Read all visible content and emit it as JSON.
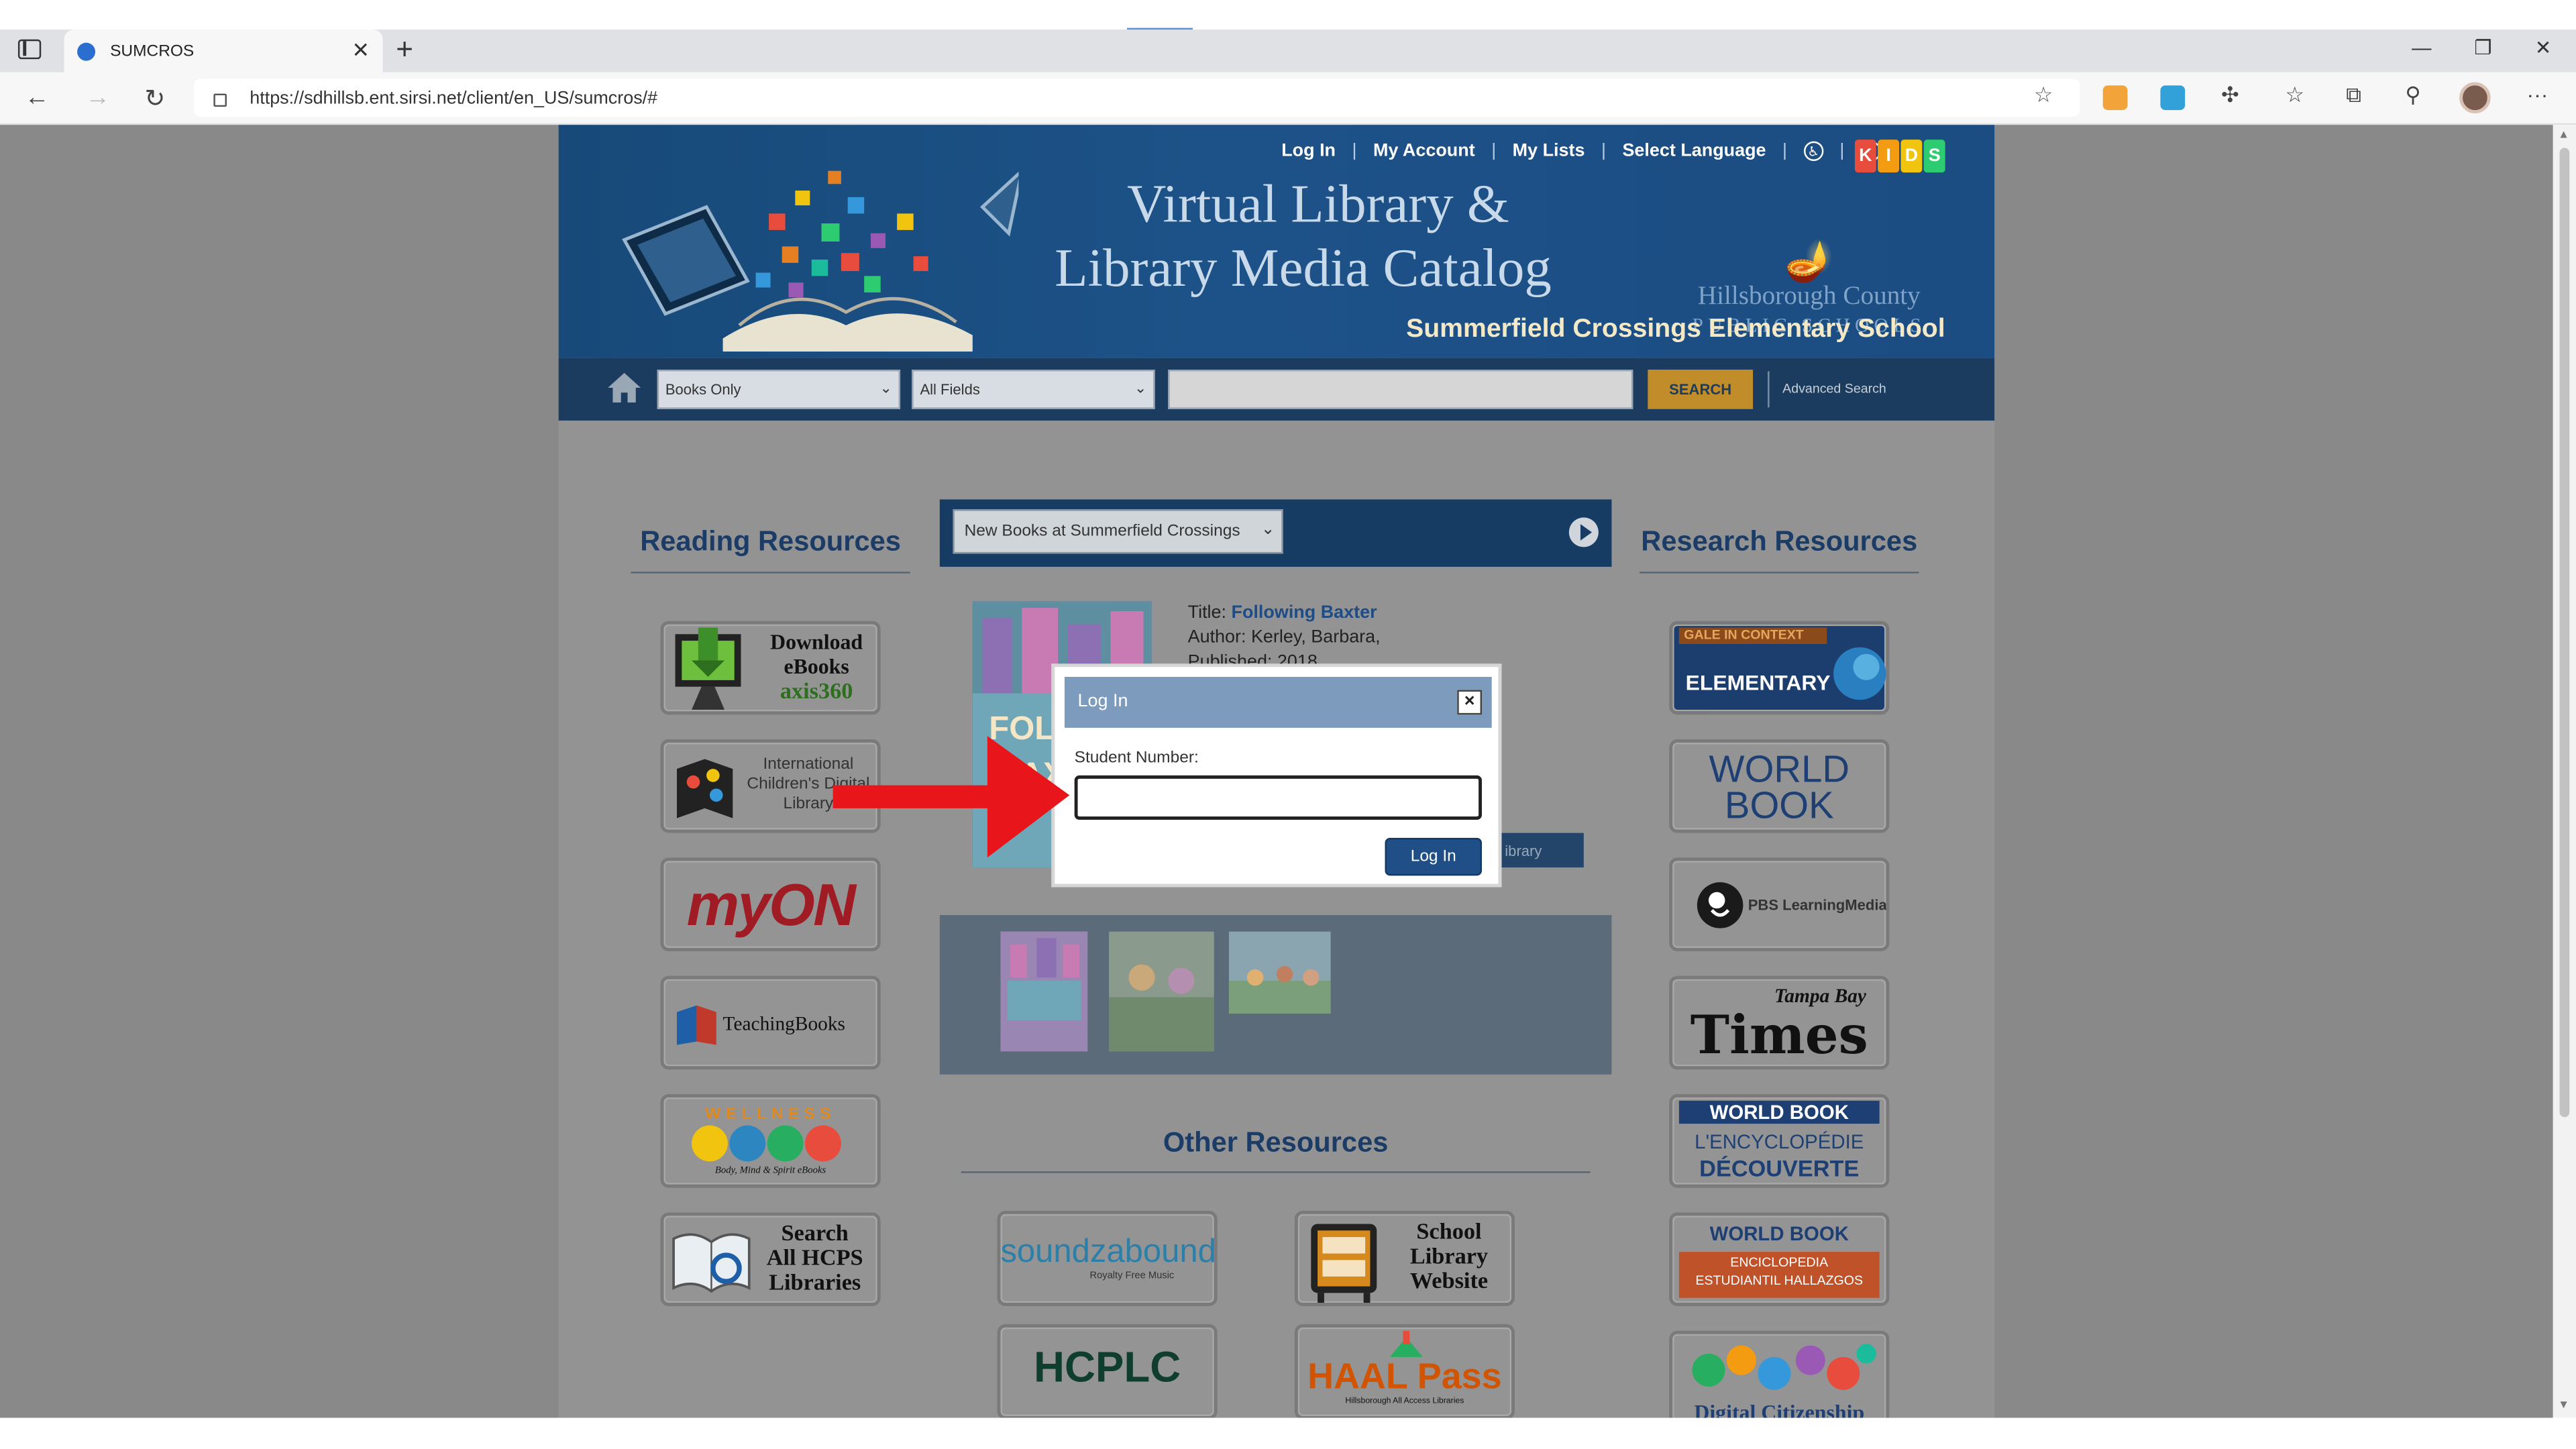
{
  "browser": {
    "tab_title": "SUMCROS",
    "url": "https://sdhillsb.ent.sirsi.net/client/en_US/sumcros/#"
  },
  "header": {
    "links": [
      "Log In",
      "My Account",
      "My Lists",
      "Select Language"
    ],
    "kids_letters": [
      "K",
      "I",
      "D",
      "S"
    ],
    "title_line1": "Virtual Library &",
    "title_line2": "Library Media Catalog",
    "district_line1": "Hillsborough County",
    "district_line2": "PUBLIC SCHOOLS",
    "school_name": "Summerfield Crossings Elementary School"
  },
  "search": {
    "format_select": "Books Only",
    "field_select": "All Fields",
    "query": "",
    "button": "SEARCH",
    "advanced": "Advanced Search"
  },
  "reading": {
    "heading": "Reading Resources",
    "tiles": [
      {
        "line1": "Download",
        "line2": "eBooks",
        "line3": "axis360"
      },
      {
        "line1": "International",
        "line2": "Children's Digital",
        "line3": "Library"
      },
      {
        "label": "myON"
      },
      {
        "label": "TeachingBooks"
      },
      {
        "label": "WELLNESS",
        "sub": "Body, Mind & Spirit eBooks"
      },
      {
        "line1": "Search",
        "line2": "All HCPS",
        "line3": "Libraries"
      }
    ]
  },
  "carousel": {
    "select": "New Books at Summerfield Crossings",
    "title_label": "Title:",
    "title": "Following Baxter",
    "author": "Author: Kerley, Barbara,",
    "published": "Published: 2018",
    "library_button": "ibrary"
  },
  "research": {
    "heading": "Research Resources",
    "tiles": [
      {
        "line1": "GALE IN CONTEXT",
        "line2": "ELEMENTARY"
      },
      {
        "line1": "WORLD",
        "line2": "BOOK"
      },
      {
        "label": "PBS LearningMedia"
      },
      {
        "line1": "Tampa Bay",
        "line2": "Times"
      },
      {
        "line1": "WORLD BOOK",
        "line2": "L'ENCYCLOPÉDIE",
        "line3": "DÉCOUVERTE"
      },
      {
        "line1": "WORLD BOOK",
        "line2": "ENCICLOPEDIA",
        "line3": "ESTUDIANTIL HALLAZGOS"
      },
      {
        "label": "Digital Citizenship"
      }
    ]
  },
  "other": {
    "heading": "Other Resources",
    "tiles": [
      {
        "line1": "soundzabound",
        "line2": "Royalty Free Music"
      },
      {
        "line1": "School",
        "line2": "Library",
        "line3": "Website"
      },
      {
        "label": "HCPLC"
      },
      {
        "label": "HAAL Pass",
        "sub": "Hillsborough All Access Libraries"
      }
    ]
  },
  "modal": {
    "title": "Log In",
    "label": "Student Number:",
    "value": "",
    "button": "Log In",
    "close": "×"
  },
  "colors": {
    "header_blue": "#1b4c82",
    "search_bar": "#1b3c5f",
    "search_button": "#c08d2a",
    "modal_header": "#7d9bbd",
    "login_button": "#1f4f86",
    "arrow": "#e8161b"
  }
}
